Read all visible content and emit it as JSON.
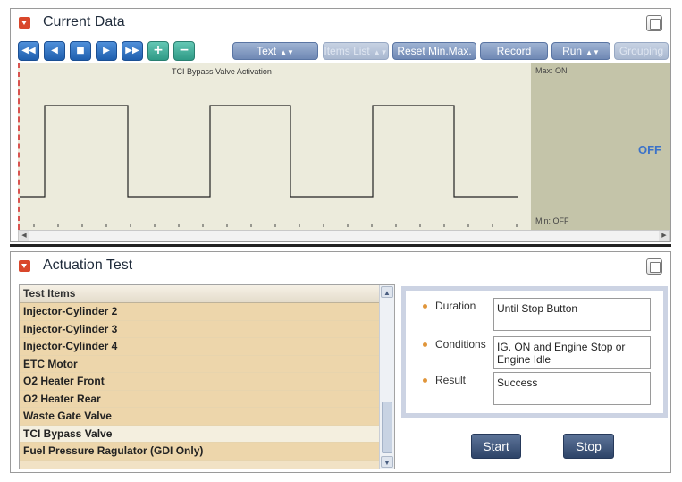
{
  "current_data": {
    "title": "Current Data",
    "toolbar": {
      "text_label": "Text",
      "items_list_label": "Items List",
      "reset_label": "Reset Min.Max.",
      "record_label": "Record",
      "run_label": "Run",
      "grouping_label": "Grouping",
      "spin_glyph": "▲▼",
      "nav_icons": [
        "rewind-icon",
        "step-back-icon",
        "stop-icon",
        "play-icon",
        "fast-forward-icon",
        "plus-icon",
        "minus-icon"
      ]
    },
    "graph": {
      "title": "TCI Bypass Valve Activation",
      "max_label": "Max: ON",
      "min_label": "Min:  OFF",
      "current_value": "OFF",
      "signal_pattern": [
        "OFF",
        "ON",
        "OFF",
        "ON",
        "OFF",
        "ON",
        "OFF"
      ]
    }
  },
  "actuation_test": {
    "title": "Actuation Test",
    "list_header": "Test Items",
    "items": [
      "Injector-Cylinder 2",
      "Injector-Cylinder 3",
      "Injector-Cylinder 4",
      "ETC Motor",
      "O2 Heater Front",
      "O2 Heater Rear",
      "Waste Gate Valve",
      "TCI Bypass Valve",
      "Fuel Pressure Ragulator (GDI Only)"
    ],
    "selected_item": "TCI Bypass Valve",
    "details": {
      "duration_label": "Duration",
      "duration_value": "Until Stop Button",
      "conditions_label": "Conditions",
      "conditions_value": "IG. ON and Engine Stop or Engine Idle",
      "result_label": "Result",
      "result_value": "Success"
    },
    "start_label": "Start",
    "stop_label": "Stop"
  },
  "colors": {
    "accent_blue": "#1f5fae",
    "graph_bg": "#ecebdc",
    "value_panel_bg": "#c4c4a9",
    "list_bg": "#edd6ab",
    "off_value": "#3b72c9"
  }
}
